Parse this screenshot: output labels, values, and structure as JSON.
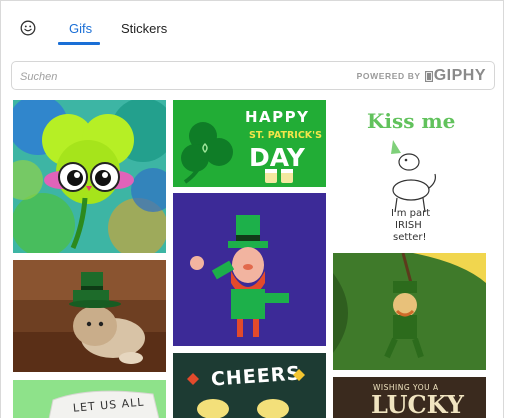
{
  "tabs": {
    "emoji_icon": "smiley-face-icon",
    "items": [
      {
        "label": "Gifs",
        "active": true
      },
      {
        "label": "Stickers",
        "active": false
      }
    ]
  },
  "search": {
    "placeholder": "Suchen",
    "value": "",
    "powered_by": "POWERED BY",
    "brand": "GIPHY"
  },
  "gifs": {
    "col1": [
      {
        "subject": "shamrock with big eyes",
        "text": ""
      },
      {
        "subject": "kitten wearing leprechaun hat",
        "text": ""
      },
      {
        "subject": "Let us all",
        "text": "LET US ALL"
      }
    ],
    "col2": [
      {
        "subject": "happy st patrick's day",
        "line1": "HAPPY",
        "line2": "ST. PATRICK'S",
        "line3": "DAY"
      },
      {
        "subject": "dancing leprechaun",
        "text": ""
      },
      {
        "subject": "cheers",
        "text": "CHEERS"
      }
    ],
    "col3": [
      {
        "subject": "kiss me i'm part irish setter",
        "title": "Kiss me",
        "caption_1": "I'm part",
        "caption_2": "IRISH",
        "caption_3": "setter!"
      },
      {
        "subject": "leprechaun swinging",
        "text": ""
      },
      {
        "subject": "wishing you a lucky",
        "line1": "WISHING YOU A",
        "line2": "LUCKY"
      }
    ]
  },
  "colors": {
    "accent": "#1a6fd6",
    "border": "#d6d6d6"
  }
}
